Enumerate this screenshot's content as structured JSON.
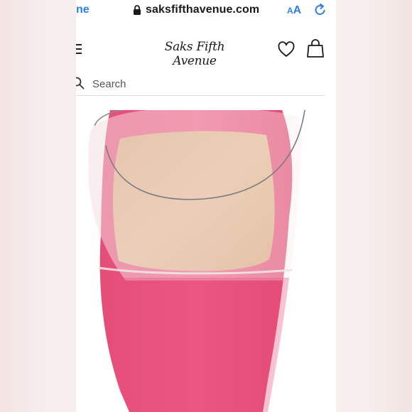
{
  "browser": {
    "tab_stub": "ne",
    "url": "saksfifthavenue.com",
    "text_size_small": "A",
    "text_size_big": "A",
    "icons": [
      "lock-icon",
      "reload-icon"
    ]
  },
  "header": {
    "logo_text": "Saks Fifth Avenue",
    "icons": [
      "menu-icon",
      "heart-icon",
      "shopping-bag-icon"
    ]
  },
  "search": {
    "label": "Search",
    "icon": "search-icon"
  },
  "colors": {
    "link_blue": "#2f7fe0",
    "shoe_pink": "#e9527e",
    "insole_tan": "#dcb187"
  }
}
